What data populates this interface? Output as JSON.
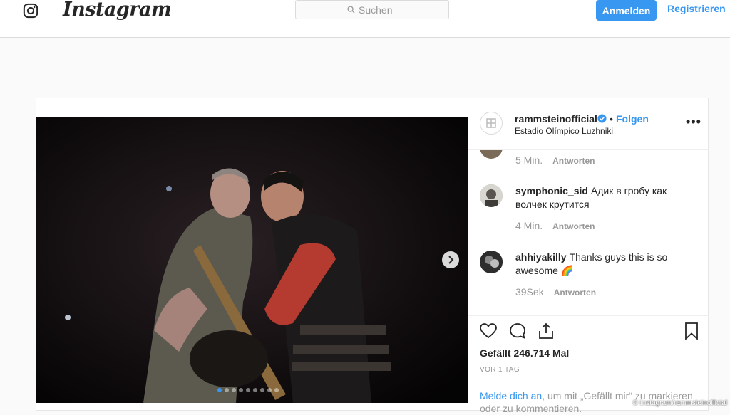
{
  "app": {
    "wordmark": "Instagram"
  },
  "topbar": {
    "search_placeholder": "Suchen",
    "login_label": "Anmelden",
    "register_label": "Registrieren"
  },
  "post": {
    "username": "rammsteinofficial",
    "follow_label": "Folgen",
    "bullet": "•",
    "location": "Estadio Olímpico Luzhniki",
    "more": "•••",
    "carousel_slides": 9,
    "carousel_active_index": 0,
    "comments": [
      {
        "user": "",
        "text": "",
        "time": "5 Min.",
        "reply": "Antworten"
      },
      {
        "user": "symphonic_sid",
        "text": "Адик в гробу как волчек крутится",
        "time": "4 Min.",
        "reply": "Antworten"
      },
      {
        "user": "ahhiyakilly",
        "text": "Thanks guys this is so awesome 🌈",
        "time": "39Sek",
        "reply": "Antworten"
      }
    ],
    "likes": "Gefällt 246.714 Mal",
    "posted": "VOR 1 TAG",
    "login_link": "Melde dich an",
    "login_rest": ", um mit „Gefällt mir“ zu markieren oder zu kommentieren."
  },
  "credit": "© Instagram/rammsteinofficial",
  "colors": {
    "accent": "#3897f0",
    "text": "#262626",
    "muted": "#999999",
    "border": "#dbdbdb"
  },
  "icons": [
    "instagram-glyph-icon",
    "search-icon",
    "verified-badge-icon",
    "more-options-icon",
    "heart-icon",
    "comment-icon",
    "share-icon",
    "bookmark-icon",
    "chevron-right-icon"
  ]
}
